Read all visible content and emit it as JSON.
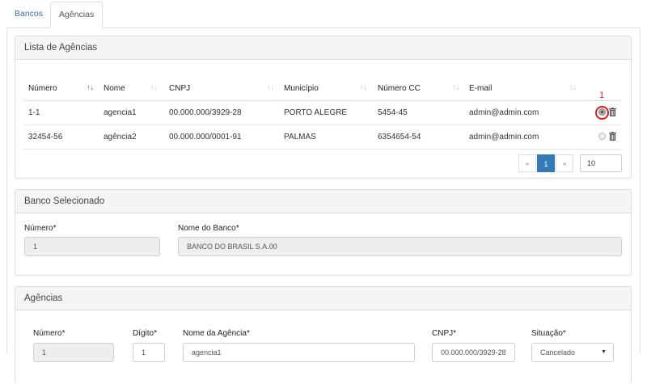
{
  "tabs": [
    {
      "label": "Bancos"
    },
    {
      "label": "Agências"
    }
  ],
  "lista": {
    "title": "Lista de Agências",
    "columns": [
      "Número",
      "Nome",
      "CNPJ",
      "Município",
      "Número CC",
      "E-mail"
    ],
    "rows": [
      {
        "numero": "1-1",
        "nome": "agencia1",
        "cnpj": "00.000.000/3929-28",
        "municipio": "PORTO ALEGRE",
        "numero_cc": "5454-45",
        "email": "admin@admin.com",
        "selected": true
      },
      {
        "numero": "32454-56",
        "nome": "agência2",
        "cnpj": "00.000.000/0001-91",
        "municipio": "PALMAS",
        "numero_cc": "6354654-54",
        "email": "admin@admin.com",
        "selected": false
      }
    ],
    "annotation": "1",
    "pagination": {
      "prev": "«",
      "current": "1",
      "next": "»",
      "page_size": "10"
    }
  },
  "banco": {
    "title": "Banco Selecionado",
    "numero_label": "Número*",
    "numero_value": "1",
    "nome_label": "Nome do Banco*",
    "nome_value": "BANCO DO BRASIL S.A.00"
  },
  "agencias": {
    "title": "Agências",
    "numero_label": "Número*",
    "numero_value": "1",
    "digito_label": "Dígito*",
    "digito_value": "1",
    "nome_label": "Nome da Agência*",
    "nome_value": "agencia1",
    "cnpj_label": "CNPJ*",
    "cnpj_value": "00.000.000/3929-28",
    "situacao_label": "Situação*",
    "situacao_value": "Cancelado"
  },
  "icons": {
    "sort": "sort-icon",
    "trash": "trash-icon",
    "radio": "radio-icon"
  },
  "colors": {
    "accent": "#337ab7",
    "annotation": "#d42020",
    "tab_link": "#3a6ea5"
  }
}
